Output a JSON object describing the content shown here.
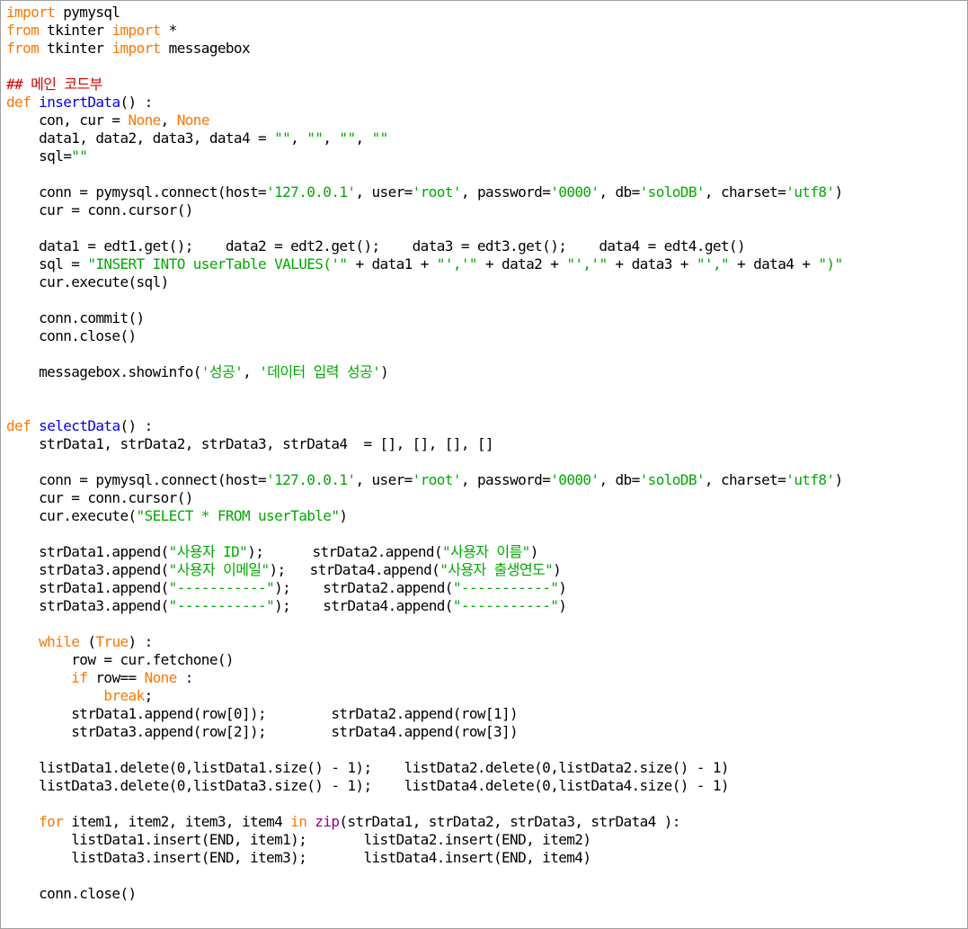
{
  "editor": {
    "colors": {
      "default": "#000000",
      "keyword": "#ff7700",
      "builtin": "#900090",
      "string": "#00aa00",
      "comment": "#dd0000",
      "defname": "#0000ff"
    },
    "lines": [
      [
        [
          "keyword",
          "import"
        ],
        [
          "default",
          " pymysql"
        ]
      ],
      [
        [
          "keyword",
          "from"
        ],
        [
          "default",
          " tkinter "
        ],
        [
          "keyword",
          "import"
        ],
        [
          "default",
          " *"
        ]
      ],
      [
        [
          "keyword",
          "from"
        ],
        [
          "default",
          " tkinter "
        ],
        [
          "keyword",
          "import"
        ],
        [
          "default",
          " messagebox"
        ]
      ],
      [],
      [
        [
          "comment",
          "## 메인 코드부"
        ]
      ],
      [
        [
          "keyword",
          "def"
        ],
        [
          "default",
          " "
        ],
        [
          "defname",
          "insertData"
        ],
        [
          "default",
          "() :"
        ]
      ],
      [
        [
          "default",
          "    con, cur = "
        ],
        [
          "keyword",
          "None"
        ],
        [
          "default",
          ", "
        ],
        [
          "keyword",
          "None"
        ]
      ],
      [
        [
          "default",
          "    data1, data2, data3, data4 = "
        ],
        [
          "string",
          "\"\""
        ],
        [
          "default",
          ", "
        ],
        [
          "string",
          "\"\""
        ],
        [
          "default",
          ", "
        ],
        [
          "string",
          "\"\""
        ],
        [
          "default",
          ", "
        ],
        [
          "string",
          "\"\""
        ]
      ],
      [
        [
          "default",
          "    sql="
        ],
        [
          "string",
          "\"\""
        ]
      ],
      [],
      [
        [
          "default",
          "    conn = pymysql.connect(host="
        ],
        [
          "string",
          "'127.0.0.1'"
        ],
        [
          "default",
          ", user="
        ],
        [
          "string",
          "'root'"
        ],
        [
          "default",
          ", password="
        ],
        [
          "string",
          "'0000'"
        ],
        [
          "default",
          ", db="
        ],
        [
          "string",
          "'soloDB'"
        ],
        [
          "default",
          ", charset="
        ],
        [
          "string",
          "'utf8'"
        ],
        [
          "default",
          ")"
        ]
      ],
      [
        [
          "default",
          "    cur = conn.cursor()"
        ]
      ],
      [],
      [
        [
          "default",
          "    data1 = edt1.get();    data2 = edt2.get();    data3 = edt3.get();    data4 = edt4.get()"
        ]
      ],
      [
        [
          "default",
          "    sql = "
        ],
        [
          "string",
          "\"INSERT INTO userTable VALUES('\""
        ],
        [
          "default",
          " + data1 + "
        ],
        [
          "string",
          "\"','\""
        ],
        [
          "default",
          " + data2 + "
        ],
        [
          "string",
          "\"','\""
        ],
        [
          "default",
          " + data3 + "
        ],
        [
          "string",
          "\"',\""
        ],
        [
          "default",
          " + data4 + "
        ],
        [
          "string",
          "\")\""
        ]
      ],
      [
        [
          "default",
          "    cur.execute(sql)"
        ]
      ],
      [],
      [
        [
          "default",
          "    conn.commit()"
        ]
      ],
      [
        [
          "default",
          "    conn.close()"
        ]
      ],
      [],
      [
        [
          "default",
          "    messagebox.showinfo("
        ],
        [
          "string",
          "'성공'"
        ],
        [
          "default",
          ", "
        ],
        [
          "string",
          "'데이터 입력 성공'"
        ],
        [
          "default",
          ")"
        ]
      ],
      [],
      [],
      [
        [
          "keyword",
          "def"
        ],
        [
          "default",
          " "
        ],
        [
          "defname",
          "selectData"
        ],
        [
          "default",
          "() :"
        ]
      ],
      [
        [
          "default",
          "    strData1, strData2, strData3, strData4  = [], [], [], []"
        ]
      ],
      [],
      [
        [
          "default",
          "    conn = pymysql.connect(host="
        ],
        [
          "string",
          "'127.0.0.1'"
        ],
        [
          "default",
          ", user="
        ],
        [
          "string",
          "'root'"
        ],
        [
          "default",
          ", password="
        ],
        [
          "string",
          "'0000'"
        ],
        [
          "default",
          ", db="
        ],
        [
          "string",
          "'soloDB'"
        ],
        [
          "default",
          ", charset="
        ],
        [
          "string",
          "'utf8'"
        ],
        [
          "default",
          ")"
        ]
      ],
      [
        [
          "default",
          "    cur = conn.cursor()"
        ]
      ],
      [
        [
          "default",
          "    cur.execute("
        ],
        [
          "string",
          "\"SELECT * FROM userTable\""
        ],
        [
          "default",
          ")"
        ]
      ],
      [],
      [
        [
          "default",
          "    strData1.append("
        ],
        [
          "string",
          "\"사용자 ID\""
        ],
        [
          "default",
          ");      strData2.append("
        ],
        [
          "string",
          "\"사용자 이름\""
        ],
        [
          "default",
          ")"
        ]
      ],
      [
        [
          "default",
          "    strData3.append("
        ],
        [
          "string",
          "\"사용자 이메일\""
        ],
        [
          "default",
          ");   strData4.append("
        ],
        [
          "string",
          "\"사용자 출생연도\""
        ],
        [
          "default",
          ")"
        ]
      ],
      [
        [
          "default",
          "    strData1.append("
        ],
        [
          "string",
          "\"-----------\""
        ],
        [
          "default",
          ");    strData2.append("
        ],
        [
          "string",
          "\"-----------\""
        ],
        [
          "default",
          ")"
        ]
      ],
      [
        [
          "default",
          "    strData3.append("
        ],
        [
          "string",
          "\"-----------\""
        ],
        [
          "default",
          ");    strData4.append("
        ],
        [
          "string",
          "\"-----------\""
        ],
        [
          "default",
          ")"
        ]
      ],
      [],
      [
        [
          "default",
          "    "
        ],
        [
          "keyword",
          "while"
        ],
        [
          "default",
          " ("
        ],
        [
          "keyword",
          "True"
        ],
        [
          "default",
          ") :"
        ]
      ],
      [
        [
          "default",
          "        row = cur.fetchone()"
        ]
      ],
      [
        [
          "default",
          "        "
        ],
        [
          "keyword",
          "if"
        ],
        [
          "default",
          " row== "
        ],
        [
          "keyword",
          "None"
        ],
        [
          "default",
          " :"
        ]
      ],
      [
        [
          "default",
          "            "
        ],
        [
          "keyword",
          "break"
        ],
        [
          "default",
          ";"
        ]
      ],
      [
        [
          "default",
          "        strData1.append(row[0]);        strData2.append(row[1])"
        ]
      ],
      [
        [
          "default",
          "        strData3.append(row[2]);        strData4.append(row[3])"
        ]
      ],
      [],
      [
        [
          "default",
          "    listData1.delete(0,listData1.size() - 1);    listData2.delete(0,listData2.size() - 1)"
        ]
      ],
      [
        [
          "default",
          "    listData3.delete(0,listData3.size() - 1);    listData4.delete(0,listData4.size() - 1)"
        ]
      ],
      [],
      [
        [
          "default",
          "    "
        ],
        [
          "keyword",
          "for"
        ],
        [
          "default",
          " item1, item2, item3, item4 "
        ],
        [
          "keyword",
          "in"
        ],
        [
          "default",
          " "
        ],
        [
          "builtin",
          "zip"
        ],
        [
          "default",
          "(strData1, strData2, strData3, strData4 ):"
        ]
      ],
      [
        [
          "default",
          "        listData1.insert(END, item1);       listData2.insert(END, item2)"
        ]
      ],
      [
        [
          "default",
          "        listData3.insert(END, item3);       listData4.insert(END, item4)"
        ]
      ],
      [],
      [
        [
          "default",
          "    conn.close()"
        ]
      ]
    ]
  }
}
